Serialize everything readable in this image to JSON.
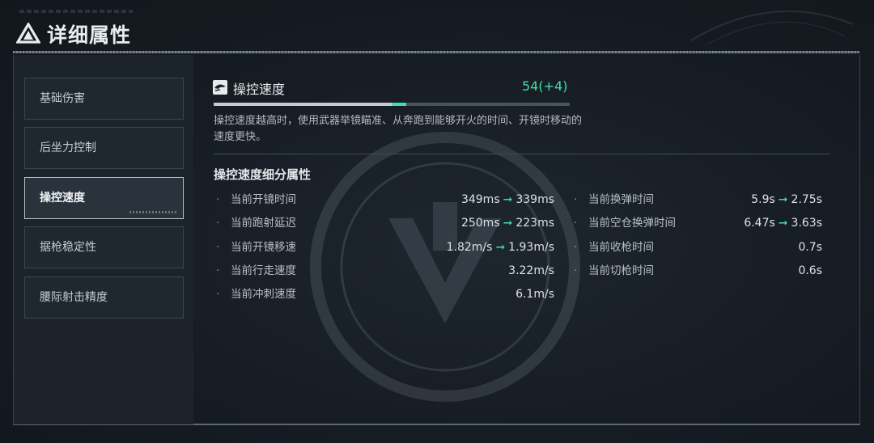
{
  "header": {
    "title": "详细属性",
    "logo_icon": "triangle-a-logo"
  },
  "sidebar": {
    "items": [
      {
        "label": "基础伤害",
        "active": false
      },
      {
        "label": "后坐力控制",
        "active": false
      },
      {
        "label": "操控速度",
        "active": true
      },
      {
        "label": "据枪稳定性",
        "active": false
      },
      {
        "label": "腰际射击精度",
        "active": false
      }
    ]
  },
  "stat": {
    "icon": "hand-speed-icon",
    "name": "操控速度",
    "value": "54(+4)",
    "base_fraction": 0.5,
    "bonus_fraction": 0.04,
    "description": "操控速度越高时，使用武器举镜瞄准、从奔跑到能够开火的时间、开镜时移动的速度更快。"
  },
  "breakdown": {
    "title": "操控速度细分属性",
    "left": [
      {
        "label": "当前开镜时间",
        "from": "349ms",
        "to": "339ms"
      },
      {
        "label": "当前跑射延迟",
        "from": "250ms",
        "to": "223ms"
      },
      {
        "label": "当前开镜移速",
        "from": "1.82m/s",
        "to": "1.93m/s"
      },
      {
        "label": "当前行走速度",
        "from": "",
        "to": "3.22m/s"
      },
      {
        "label": "当前冲刺速度",
        "from": "",
        "to": "6.1m/s"
      }
    ],
    "right": [
      {
        "label": "当前换弹时间",
        "from": "5.9s",
        "to": "2.75s"
      },
      {
        "label": "当前空仓换弹时间",
        "from": "6.47s",
        "to": "3.63s"
      },
      {
        "label": "当前收枪时间",
        "from": "",
        "to": "0.7s"
      },
      {
        "label": "当前切枪时间",
        "from": "",
        "to": "0.6s"
      }
    ]
  },
  "colors": {
    "accent": "#3fe0a8",
    "background": "#151b22",
    "panel": "#1c232b"
  }
}
